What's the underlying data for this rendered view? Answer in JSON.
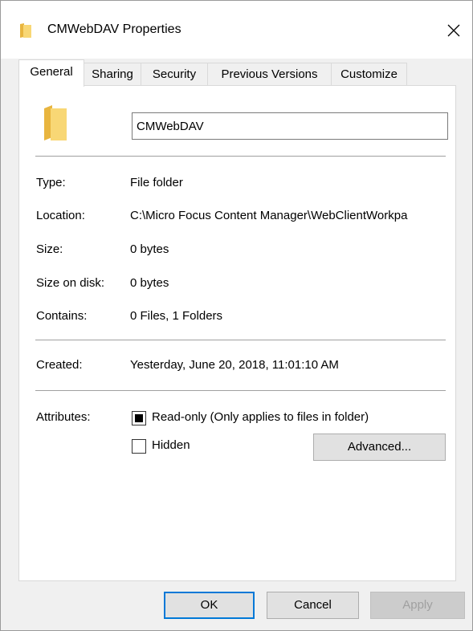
{
  "window": {
    "title": "CMWebDAV Properties",
    "folder_color": "#f8d775",
    "accent": "#0078d7"
  },
  "tabs": [
    {
      "label": "General",
      "active": true
    },
    {
      "label": "Sharing",
      "active": false
    },
    {
      "label": "Security",
      "active": false
    },
    {
      "label": "Previous Versions",
      "active": false
    },
    {
      "label": "Customize",
      "active": false
    }
  ],
  "general": {
    "folder_name": "CMWebDAV",
    "type_label": "Type:",
    "type_value": "File folder",
    "location_label": "Location:",
    "location_value": "C:\\Micro Focus Content Manager\\WebClientWorkpa",
    "size_label": "Size:",
    "size_value": "0 bytes",
    "size_on_disk_label": "Size on disk:",
    "size_on_disk_value": "0 bytes",
    "contains_label": "Contains:",
    "contains_value": "0 Files, 1 Folders",
    "created_label": "Created:",
    "created_value": "Yesterday, June 20, 2018, 11:01:10 AM",
    "attributes_label": "Attributes:",
    "readonly_label": "Read-only (Only applies to files in folder)",
    "readonly_state": "indeterminate",
    "hidden_label": "Hidden",
    "hidden_checked": false,
    "advanced_label": "Advanced..."
  },
  "footer": {
    "ok_label": "OK",
    "cancel_label": "Cancel",
    "apply_label": "Apply"
  }
}
